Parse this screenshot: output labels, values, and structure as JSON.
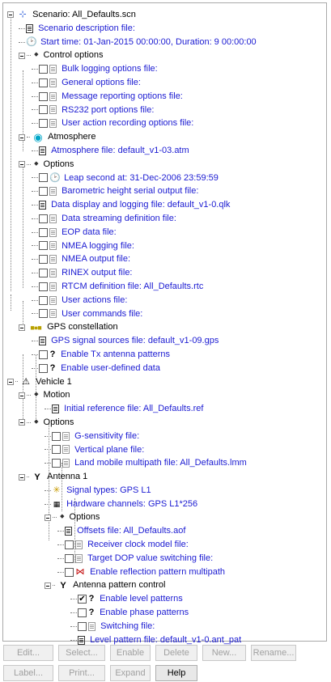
{
  "tree": {
    "scenario": "Scenario: All_Defaults.scn",
    "scenario_description": "Scenario description file:",
    "start_time": "Start time: 01-Jan-2015 00:00:00, Duration: 9 00:00:00",
    "control_options": {
      "label": "Control options",
      "items": [
        "Bulk logging options file:",
        "General options file:",
        "Message reporting options file:",
        "RS232 port options file:",
        "User action recording options file:"
      ]
    },
    "atmosphere": {
      "label": "Atmosphere",
      "file": "Atmosphere file: default_v1-03.atm"
    },
    "options": {
      "label": "Options",
      "leap_second": "Leap second at: 31-Dec-2006 23:59:59",
      "items": [
        "Barometric height serial output file:",
        "Data display and logging file: default_v1-0.qlk",
        "Data streaming definition file:",
        "EOP data file:",
        "NMEA logging file:",
        "NMEA output file:",
        "RINEX output file:",
        "RTCM definition file: All_Defaults.rtc",
        "User actions file:",
        "User commands file:"
      ]
    },
    "gps_constellation": {
      "label": "GPS constellation",
      "signal_sources": "GPS signal sources file: default_v1-09.gps",
      "tx_patterns": "Enable Tx antenna patterns",
      "user_data": "Enable user-defined data"
    },
    "vehicle": {
      "label": "Vehicle 1",
      "motion": {
        "label": "Motion",
        "ref_file": "Initial reference file: All_Defaults.ref"
      },
      "options": {
        "label": "Options",
        "items": [
          "G-sensitivity file:",
          "Vertical plane file:",
          "Land mobile multipath file: All_Defaults.lmm"
        ]
      },
      "antenna": {
        "label": "Antenna  1",
        "signal_types": "Signal types: GPS L1",
        "hardware_channels": "Hardware channels: GPS L1*256",
        "options": {
          "label": "Options",
          "offsets": "Offsets file: All_Defaults.aof",
          "items": [
            "Receiver clock model file:",
            "Target DOP value switching file:",
            "Enable reflection pattern multipath"
          ]
        },
        "pattern_control": {
          "label": "Antenna pattern control",
          "level_patterns": "Enable level patterns",
          "phase_patterns": "Enable phase patterns",
          "switching": "Switching file:",
          "level_pattern_file": "Level pattern file: default_v1-0.ant_pat"
        }
      }
    }
  },
  "buttons": {
    "edit": "Edit...",
    "select": "Select...",
    "enable": "Enable",
    "delete": "Delete",
    "new": "New...",
    "rename": "Rename...",
    "label": "Label...",
    "print": "Print...",
    "expand": "Expand",
    "help": "Help"
  },
  "colors": {
    "link": "#1b1bd2",
    "atmosphere": "#00a6c8"
  },
  "check_states": {
    "enable_level_patterns": true
  }
}
